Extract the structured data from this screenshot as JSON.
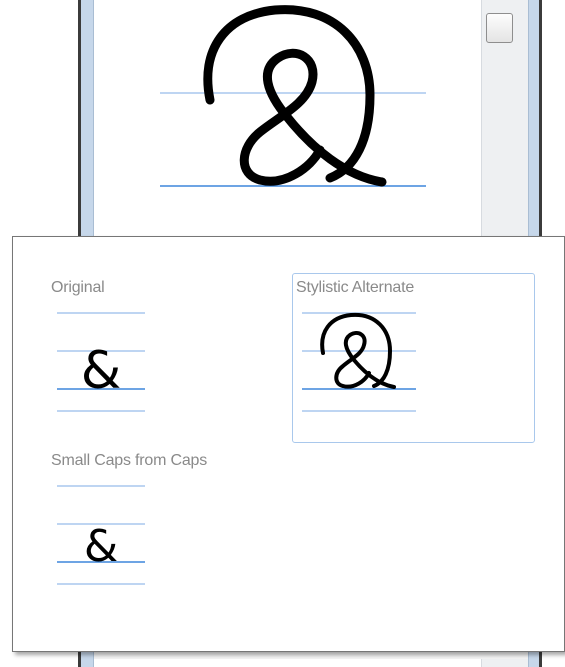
{
  "preview": {
    "glyph": "&",
    "variant": "Stylistic Alternate",
    "guide_color": "#a8c7ee",
    "baseline_color": "#3d86dc"
  },
  "popup": {
    "options": [
      {
        "label": "Original",
        "glyph": "&",
        "selected": false
      },
      {
        "label": "Stylistic Alternate",
        "glyph": "&",
        "selected": true
      },
      {
        "label": "Small Caps from Caps",
        "glyph": "&",
        "selected": false
      }
    ]
  },
  "colors": {
    "label": "#8a8a8a",
    "selection_border": "#a9c8ec",
    "glyph": "#000000"
  }
}
